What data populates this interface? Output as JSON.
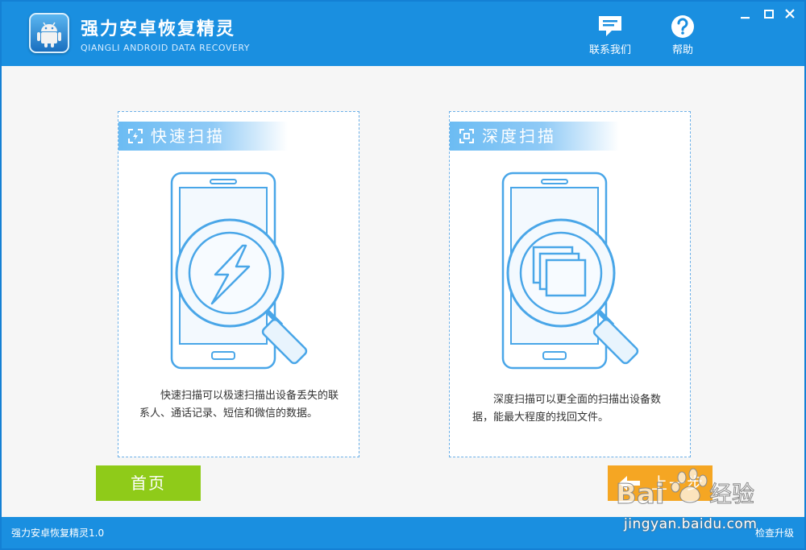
{
  "app": {
    "title": "强力安卓恢复精灵",
    "subtitle": "QIANGLI ANDROID DATA RECOVERY"
  },
  "toolbar": {
    "contact_label": "联系我们",
    "help_label": "帮助"
  },
  "panels": {
    "quick": {
      "title": "快速扫描",
      "description": "快速扫描可以极速扫描出设备丢失的联系人、通话记录、短信和微信的数据。"
    },
    "deep": {
      "title": "深度扫描",
      "description": "深度扫描可以更全面的扫描出设备数据，能最大程度的找回文件。"
    }
  },
  "buttons": {
    "home_label": "首页",
    "back_label": "上一步"
  },
  "footer": {
    "version": "强力安卓恢复精灵1.0",
    "update_label": "检查升级"
  },
  "watermark": {
    "text": "jingyan.baidu.com"
  },
  "colors": {
    "titlebar": "#1a8fe0",
    "accent_line": "#49a6e8",
    "home_button": "#8fcb19",
    "back_button": "#f5a623"
  },
  "icons": {
    "contact": "chat-icon",
    "help": "question-icon",
    "quick_scan": "lightning-icon",
    "deep_scan": "layers-icon"
  }
}
